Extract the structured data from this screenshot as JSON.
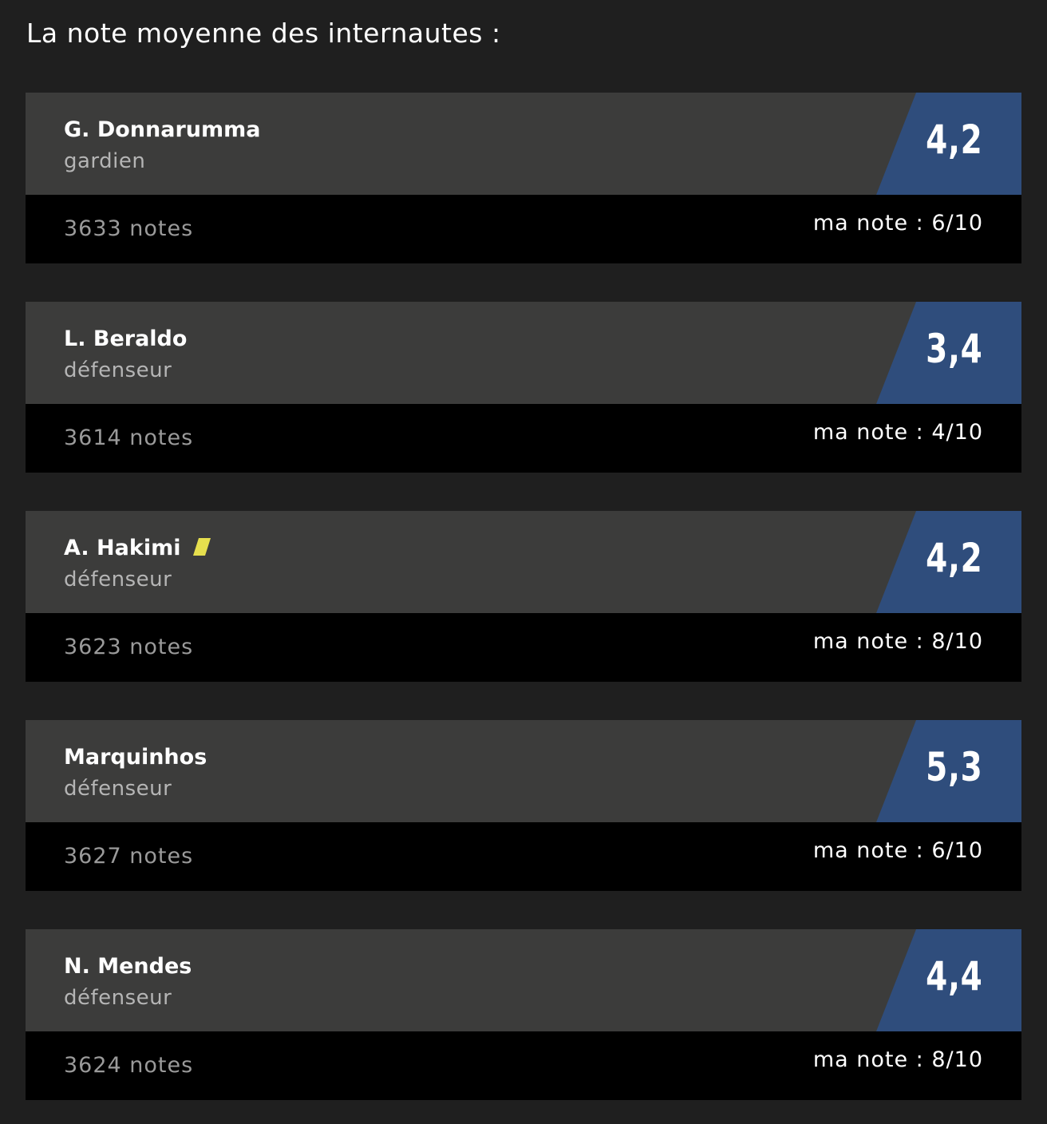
{
  "heading": "La note moyenne des internautes :",
  "colors": {
    "page_background": "#1f1f1f",
    "card_header": "#3c3c3b",
    "card_footer": "#000000",
    "rating_badge": "#2f4d7c",
    "yellow_card": "#e6df4e"
  },
  "players": [
    {
      "name": "G. Donnarumma",
      "role": "gardien",
      "average": "4,2",
      "votes": "3633 notes",
      "my_rating_label": "ma note : ",
      "my_rating_value": "6/10",
      "yellow_card": false
    },
    {
      "name": "L. Beraldo",
      "role": "défenseur",
      "average": "3,4",
      "votes": "3614 notes",
      "my_rating_label": "ma note : ",
      "my_rating_value": "4/10",
      "yellow_card": false
    },
    {
      "name": "A. Hakimi",
      "role": "défenseur",
      "average": "4,2",
      "votes": "3623 notes",
      "my_rating_label": "ma note : ",
      "my_rating_value": "8/10",
      "yellow_card": true,
      "card_icon": "yellow-card-icon"
    },
    {
      "name": "Marquinhos",
      "role": "défenseur",
      "average": "5,3",
      "votes": "3627 notes",
      "my_rating_label": "ma note : ",
      "my_rating_value": "6/10",
      "yellow_card": false
    },
    {
      "name": "N. Mendes",
      "role": "défenseur",
      "average": "4,4",
      "votes": "3624 notes",
      "my_rating_label": "ma note : ",
      "my_rating_value": "8/10",
      "yellow_card": false
    }
  ]
}
